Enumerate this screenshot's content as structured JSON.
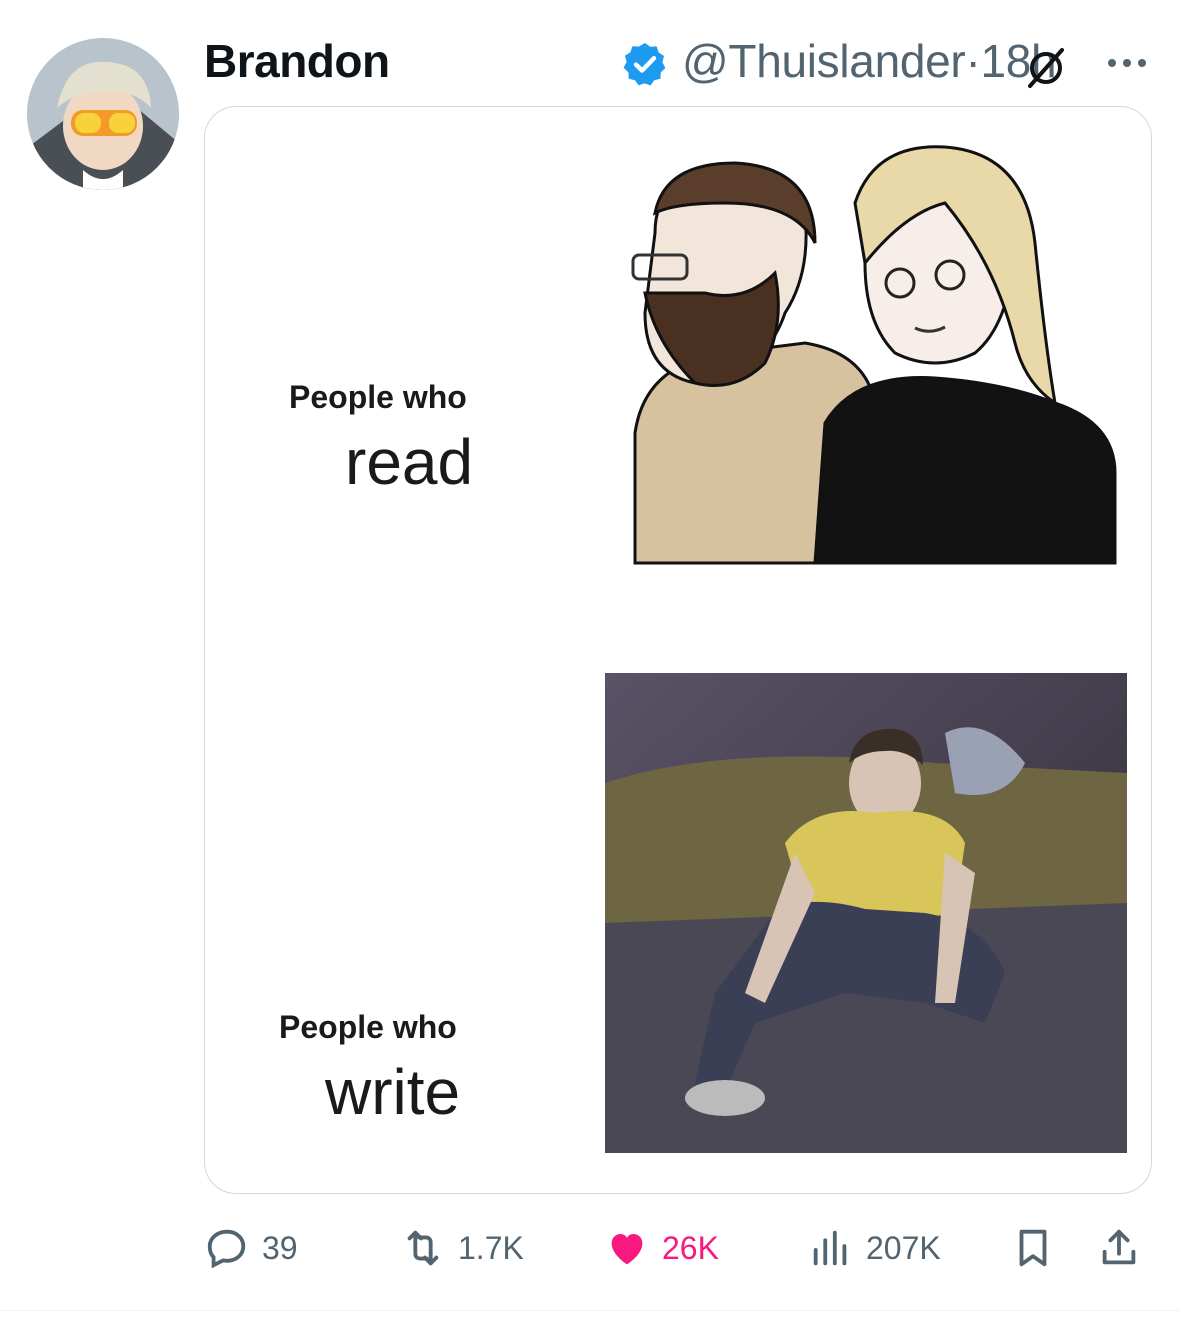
{
  "tweet": {
    "author_name": "Brandon",
    "handle": "@Thuislander",
    "separator": "·",
    "time": "18h"
  },
  "meme": {
    "top_line1": "People who",
    "top_line2": "read",
    "bottom_line1": "People who",
    "bottom_line2": "write"
  },
  "actions": {
    "replies": "39",
    "reposts": "1.7K",
    "likes": "26K",
    "views": "207K"
  },
  "colors": {
    "verified_blue": "#1d9bf0",
    "like_pink": "#f91880",
    "secondary_text": "#536471"
  },
  "icons": [
    "verified-badge-icon",
    "grok-icon",
    "more-icon",
    "reply-icon",
    "repost-icon",
    "like-icon",
    "views-icon",
    "bookmark-icon",
    "share-icon"
  ]
}
